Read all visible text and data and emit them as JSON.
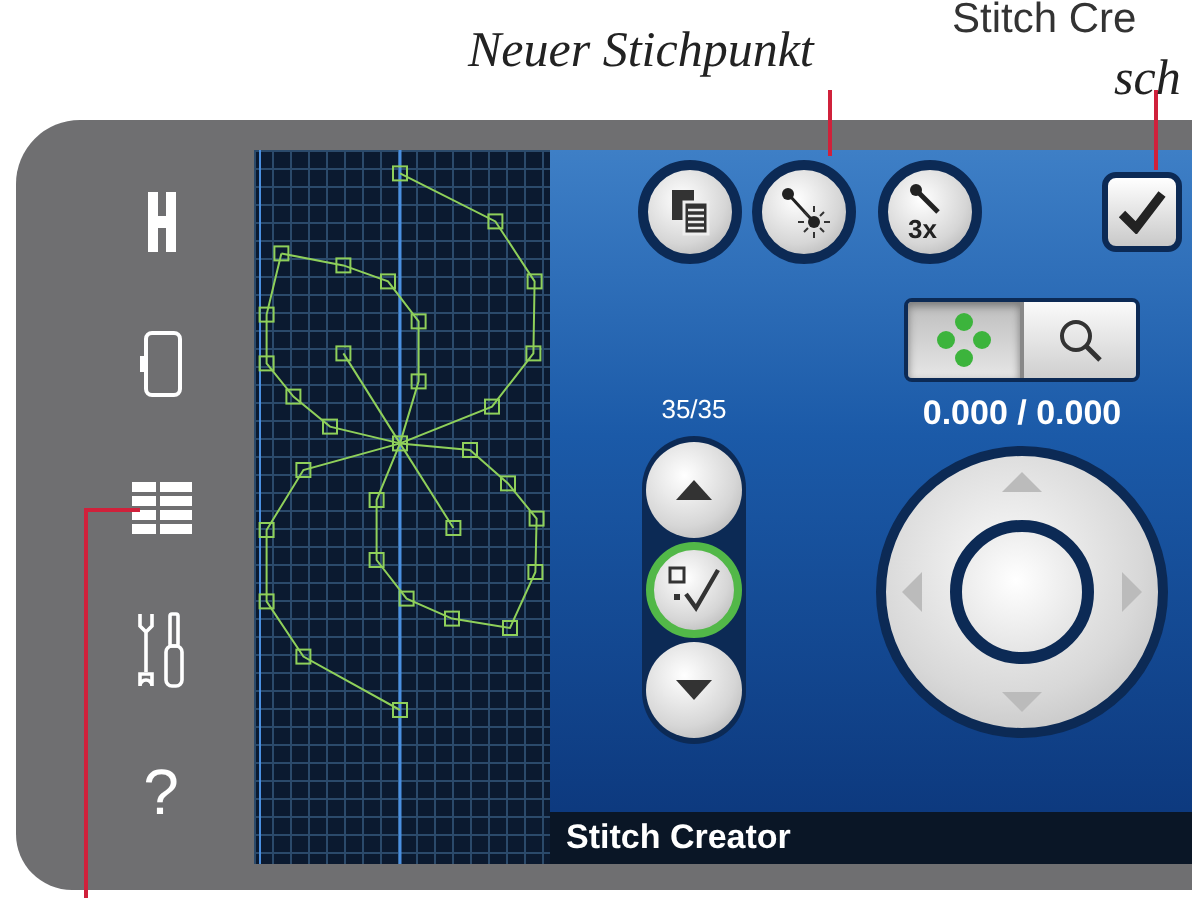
{
  "callouts": [
    {
      "text": "Neuer Stichpunkt",
      "kind": "italic"
    },
    {
      "text": "Stitch Cre",
      "kind": "plain"
    },
    {
      "text": "sch",
      "kind": "italic"
    }
  ],
  "sidebar": {
    "help_glyph": "?"
  },
  "screen": {
    "step_button": "3x",
    "view_toggle": [
      {
        "selected": true
      },
      {
        "selected": false
      }
    ],
    "stitch_counter": "35/35",
    "position": "0.000 / 0.000",
    "title": "Stitch Creator"
  }
}
